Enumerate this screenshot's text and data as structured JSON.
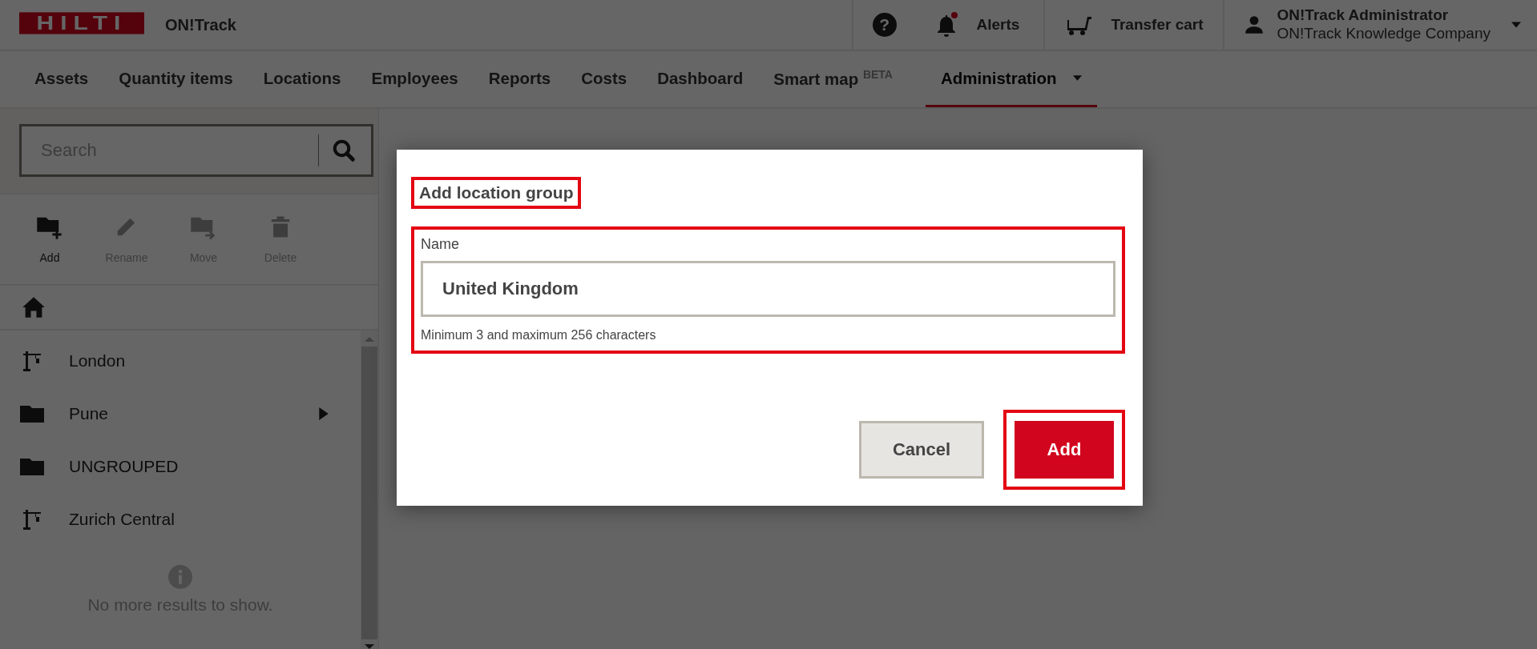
{
  "header": {
    "logo": "HILTI",
    "app_name": "ON!Track",
    "help": "?",
    "alerts": {
      "label": "Alerts",
      "unread": true
    },
    "transfer_cart": "Transfer cart",
    "user": {
      "name": "ON!Track Administrator",
      "company": "ON!Track Knowledge Company"
    }
  },
  "nav": [
    {
      "label": "Assets",
      "selected": false
    },
    {
      "label": "Quantity items",
      "selected": false
    },
    {
      "label": "Locations",
      "selected": false
    },
    {
      "label": "Employees",
      "selected": false
    },
    {
      "label": "Reports",
      "selected": false
    },
    {
      "label": "Costs",
      "selected": false
    },
    {
      "label": "Dashboard",
      "selected": false
    },
    {
      "label": "Smart map $^{BETA}$",
      "selected": false
    },
    {
      "label": "Administration",
      "selected": true,
      "dropdown": true
    }
  ],
  "search": {
    "placeholder": "Search"
  },
  "toolbar": [
    {
      "kind": "add",
      "label": "Add",
      "disabled": false
    },
    {
      "kind": "rename",
      "label": "Rename",
      "disabled": true
    },
    {
      "kind": "move",
      "label": "Move",
      "disabled": true
    },
    {
      "kind": "delete",
      "label": "Delete",
      "disabled": true
    }
  ],
  "locations": [
    {
      "kind": "site",
      "name": "London",
      "has_children": false
    },
    {
      "kind": "folder",
      "name": "Pune",
      "has_children": true
    },
    {
      "kind": "folder",
      "name": "UNGROUPED",
      "has_children": false
    },
    {
      "kind": "site",
      "name": "Zurich Central",
      "has_children": false
    }
  ],
  "list_end": "No more results to show.",
  "dialog": {
    "title": "Add location group",
    "title_highlighted": true,
    "field": {
      "label": "Name",
      "value": "United Kingdom",
      "hint": "Minimum 3 and maximum 256 characters",
      "highlighted": true
    },
    "buttons": [
      {
        "kind": "secondary",
        "label": "Cancel",
        "highlighted": false
      },
      {
        "kind": "primary",
        "label": "Add",
        "highlighted": true
      }
    ]
  }
}
